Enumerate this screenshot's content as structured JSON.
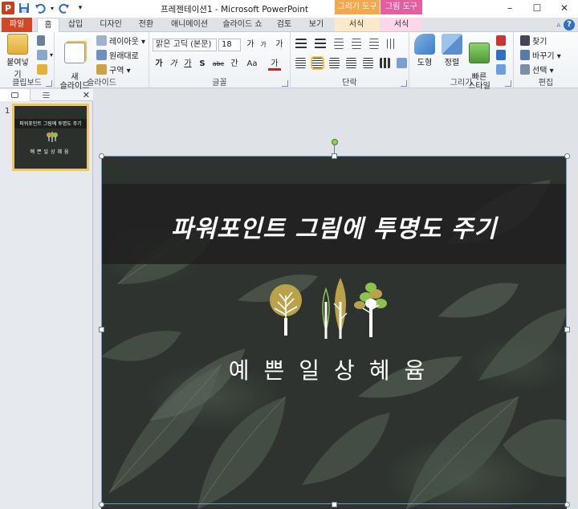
{
  "window": {
    "title": "프레젠테이션1 - Microsoft PowerPoint",
    "ctx_draw_tools": "그리기 도구",
    "ctx_picture_tools": "그림 도구",
    "minimize": "–",
    "maximize": "☐",
    "close": "✕"
  },
  "qat": {
    "app_logo": "P",
    "save": "💾",
    "undo": "↶",
    "redo": "↻",
    "customize": "▾"
  },
  "tabs": [
    "파일",
    "홈",
    "삽입",
    "디자인",
    "전환",
    "애니메이션",
    "슬라이드 쇼",
    "검토",
    "보기",
    "서식",
    "서식"
  ],
  "ribbon": {
    "clipboard": {
      "paste": "붙여넣기",
      "label": "클립보드"
    },
    "slides": {
      "new_slide": "새\n슬라이드",
      "layout": "레이아웃 ▾",
      "reset": "원래대로",
      "section": "구역 ▾",
      "label": "슬라이드"
    },
    "font": {
      "font_name": "맑은 고딕 (본문)",
      "font_size": "18",
      "grow": "가",
      "shrink": "가",
      "clear": "가",
      "bold": "가",
      "italic": "가",
      "underline": "가",
      "shadow": "S",
      "strike": "abc",
      "spacing": "간",
      "case": "Aa",
      "color": "가",
      "label": "글꼴"
    },
    "paragraph": {
      "label": "단락"
    },
    "drawing": {
      "shapes": "도형",
      "arrange": "정렬",
      "quick_styles": "빠른\n스타일",
      "label": "그리기"
    },
    "editing": {
      "find": "찾기",
      "replace": "바꾸기 ▾",
      "select": "선택 ▾",
      "label": "편집"
    }
  },
  "slide_pane": {
    "slide_number": "1",
    "thumb_title": "파워포인트 그림에 투명도 주기",
    "thumb_subtitle": "예쁜일상혜윰"
  },
  "slide": {
    "title": "파워포인트 그림에 투명도 주기",
    "subtitle": "예쁜일상혜윰"
  },
  "colors": {
    "file_tab": "#d24726",
    "draw_tools": "#f2a94d",
    "picture_tools": "#e25fa0",
    "tree_gold": "#b9a24a",
    "tree_green": "#8cc24d"
  }
}
